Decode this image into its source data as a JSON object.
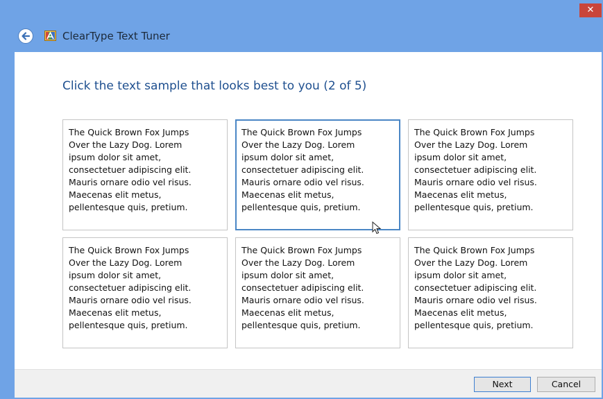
{
  "window": {
    "title": "ClearType Text Tuner",
    "close_label": "✕",
    "accent_color": "#6fa3e6",
    "icons": [
      "back-arrow-icon",
      "cleartype-app-icon",
      "close-icon"
    ]
  },
  "instruction": "Click the text sample that looks best to you (2 of 5)",
  "samples": [
    {
      "text": "The Quick Brown Fox Jumps\nOver the Lazy Dog. Lorem\nipsum dolor sit amet,\nconsectetuer adipiscing elit.\nMauris ornare odio vel risus.\nMaecenas elit metus,\npellentesque quis, pretium.",
      "selected": false
    },
    {
      "text": "The Quick Brown Fox Jumps\nOver the Lazy Dog. Lorem\nipsum dolor sit amet,\nconsectetuer adipiscing elit.\nMauris ornare odio vel risus.\nMaecenas elit metus,\npellentesque quis, pretium.",
      "selected": true
    },
    {
      "text": "The Quick Brown Fox Jumps\nOver the Lazy Dog. Lorem\nipsum dolor sit amet,\nconsectetuer adipiscing elit.\nMauris ornare odio vel risus.\nMaecenas elit metus,\npellentesque quis, pretium.",
      "selected": false
    },
    {
      "text": "The Quick Brown Fox Jumps\nOver the Lazy Dog. Lorem\nipsum dolor sit amet,\nconsectetuer adipiscing elit.\nMauris ornare odio vel risus.\nMaecenas elit metus,\npellentesque quis, pretium.",
      "selected": false
    },
    {
      "text": "The Quick Brown Fox Jumps\nOver the Lazy Dog. Lorem\nipsum dolor sit amet,\nconsectetuer adipiscing elit.\nMauris ornare odio vel risus.\nMaecenas elit metus,\npellentesque quis, pretium.",
      "selected": false
    },
    {
      "text": "The Quick Brown Fox Jumps\nOver the Lazy Dog. Lorem\nipsum dolor sit amet,\nconsectetuer adipiscing elit.\nMauris ornare odio vel risus.\nMaecenas elit metus,\npellentesque quis, pretium.",
      "selected": false
    }
  ],
  "footer": {
    "next_label": "Next",
    "cancel_label": "Cancel"
  }
}
